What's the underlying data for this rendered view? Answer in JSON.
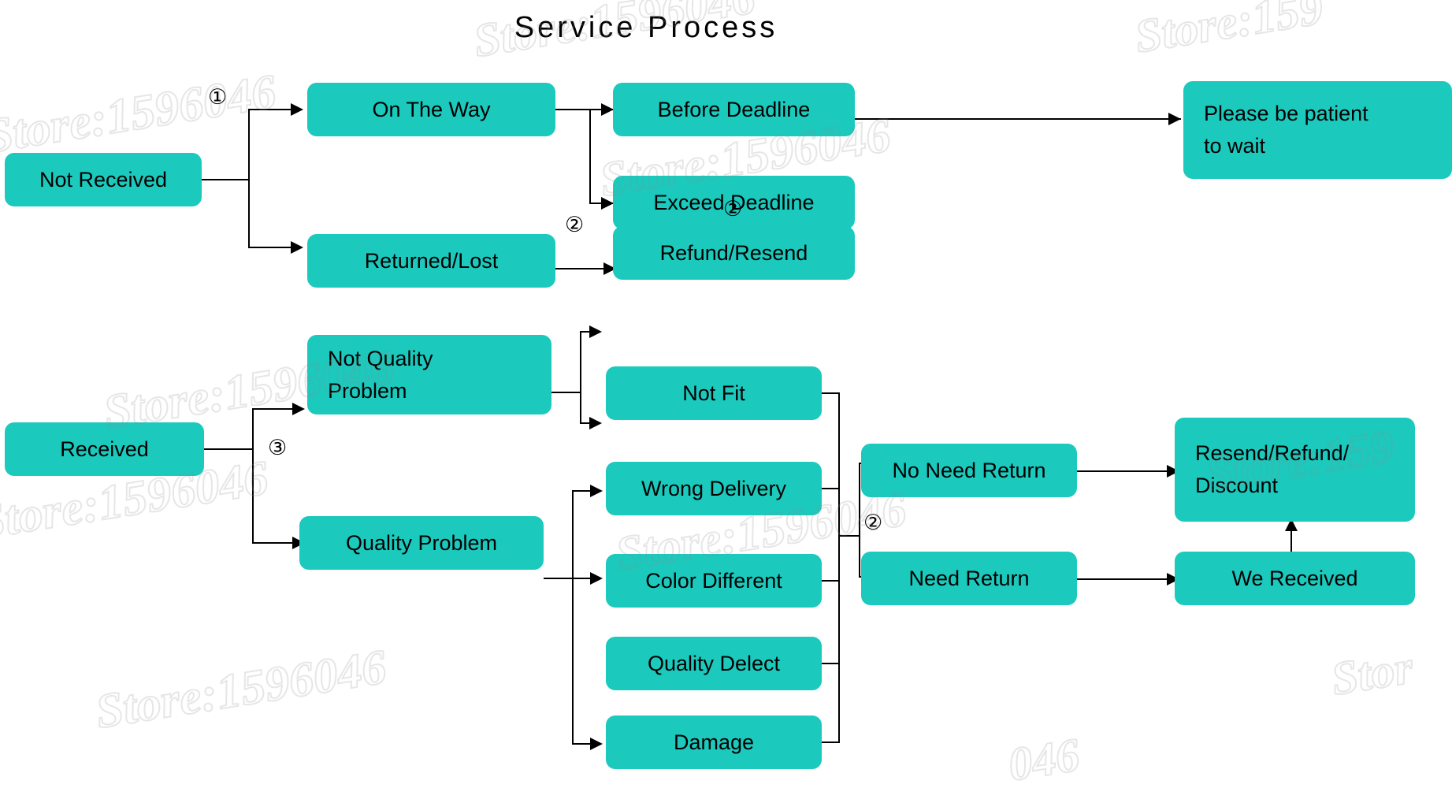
{
  "title": "Service Process",
  "colors": {
    "node_fill": "#1bc9bd",
    "line": "#000000",
    "background": "#ffffff",
    "watermark": "#8c8c8c"
  },
  "watermark": {
    "text": "Store:1596046",
    "short_texts": [
      "Store:159",
      "Store:1596046",
      "Stor",
      "046"
    ]
  },
  "markers": {
    "one": "①",
    "two": "②",
    "three": "③"
  },
  "nodes": {
    "not_received": "Not Received",
    "on_the_way": "On The Way",
    "returned_lost": "Returned/Lost",
    "before_deadline": "Before Deadline",
    "exceed_deadline": "Exceed Deadline",
    "refund_resend": "Refund/Resend",
    "please_be_patient_l1": "Please be patient",
    "please_be_patient_l2": "to wait",
    "received": "Received",
    "not_quality_problem_l1": "Not Quality",
    "not_quality_problem_l2": "Problem",
    "quality_problem": "Quality Problem",
    "not_fit": "Not Fit",
    "wrong_delivery": "Wrong Delivery",
    "color_different": "Color Different",
    "quality_delect": "Quality Delect",
    "damage": "Damage",
    "no_need_return": "No Need Return",
    "need_return": "Need Return",
    "resend_refund_discount_l1": "Resend/Refund/",
    "resend_refund_discount_l2": "Discount",
    "we_received": "We Received"
  },
  "chart_data": {
    "type": "diagram",
    "diagram_type": "flowchart",
    "title": "Service Process",
    "flows": [
      {
        "step": "①",
        "from": "Not Received",
        "to": [
          "On The Way",
          "Returned/Lost"
        ]
      },
      {
        "from": "On The Way",
        "to": [
          "Before Deadline",
          "Exceed Deadline"
        ]
      },
      {
        "from": "Before Deadline",
        "to": [
          "Please be patient to wait"
        ]
      },
      {
        "step": "②",
        "from": "Exceed Deadline",
        "to": [
          "Refund/Resend"
        ]
      },
      {
        "step": "②",
        "from": "Returned/Lost",
        "to": [
          "Refund/Resend"
        ]
      },
      {
        "step": "③",
        "from": "Received",
        "to": [
          "Not Quality Problem",
          "Quality Problem"
        ]
      },
      {
        "from": "Not Quality Problem",
        "to": [
          "Not Fit",
          "Wrong Delivery"
        ]
      },
      {
        "from": "Quality Problem",
        "to": [
          "Color Different",
          "Quality Delect",
          "Damage"
        ]
      },
      {
        "step": "②",
        "from": [
          "Not Fit",
          "Wrong Delivery",
          "Color Different",
          "Quality Delect",
          "Damage"
        ],
        "to": [
          "No Need Return",
          "Need Return"
        ]
      },
      {
        "from": "No Need Return",
        "to": [
          "Resend/Refund/Discount"
        ]
      },
      {
        "from": "Need Return",
        "to": [
          "We Received"
        ]
      },
      {
        "from": "We Received",
        "to": [
          "Resend/Refund/Discount"
        ]
      }
    ]
  }
}
